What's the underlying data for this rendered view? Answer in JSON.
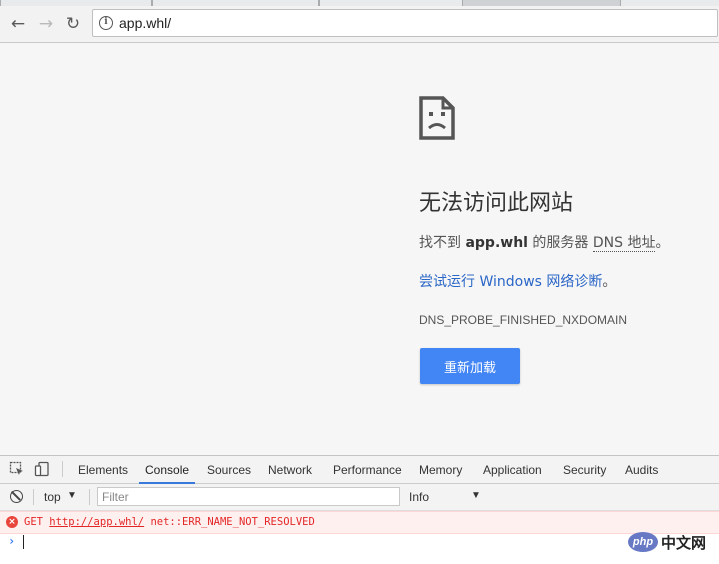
{
  "browser": {
    "url": "app.whl/",
    "back_icon": "←",
    "forward_icon": "→",
    "reload_icon": "↻",
    "info_icon": "i"
  },
  "error_page": {
    "title": "无法访问此网站",
    "desc_prefix": "找不到 ",
    "desc_host": "app.whl",
    "desc_middle": " 的服务器 ",
    "desc_dns": "DNS 地址",
    "desc_suffix": "。",
    "diagnostics_link": "尝试运行 Windows 网络诊断",
    "diagnostics_suffix": "。",
    "error_code": "DNS_PROBE_FINISHED_NXDOMAIN",
    "reload_button": "重新加载"
  },
  "devtools": {
    "tabs": [
      "Elements",
      "Console",
      "Sources",
      "Network",
      "Performance",
      "Memory",
      "Application",
      "Security",
      "Audits"
    ],
    "active_tab": "Console",
    "context": "top",
    "filter_placeholder": "Filter",
    "level": "Info",
    "error": {
      "method": "GET",
      "url": "http://app.whl/",
      "message": "net::ERR_NAME_NOT_RESOLVED"
    },
    "prompt_caret": "›"
  },
  "watermark": {
    "logo_text": "php",
    "text": "中文网"
  },
  "colors": {
    "accent_blue": "#4285f4",
    "link_blue": "#2a66c7",
    "error_red": "#e32626"
  }
}
